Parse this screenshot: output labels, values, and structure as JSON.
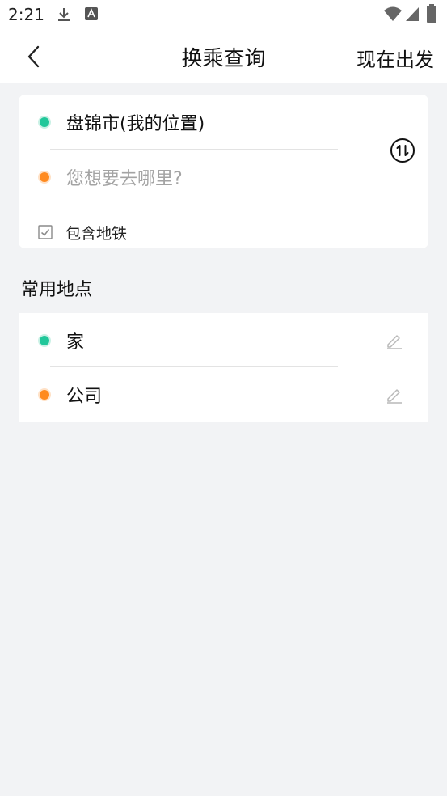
{
  "status_bar": {
    "time": "2:21",
    "icons": [
      "download-icon",
      "font-app-icon",
      "wifi-icon",
      "signal-icon",
      "battery-icon"
    ]
  },
  "header": {
    "back_icon": "chevron-left-icon",
    "title": "换乘查询",
    "action_label": "现在出发"
  },
  "route": {
    "origin": "盘锦市(我的位置)",
    "destination_placeholder": "您想要去哪里?",
    "swap_icon": "swap-icon",
    "include_subway_label": "包含地铁",
    "include_subway_checked": true
  },
  "common_places": {
    "title": "常用地点",
    "items": [
      {
        "label": "家",
        "dot_color": "#21c79a",
        "edit_icon": "pencil-icon"
      },
      {
        "label": "公司",
        "dot_color": "#ff8a1f",
        "edit_icon": "pencil-icon"
      }
    ]
  },
  "colors": {
    "background": "#f2f3f5",
    "origin_dot": "#21c79a",
    "destination_dot": "#ff8a1f",
    "placeholder_text": "#a3a3a3"
  }
}
